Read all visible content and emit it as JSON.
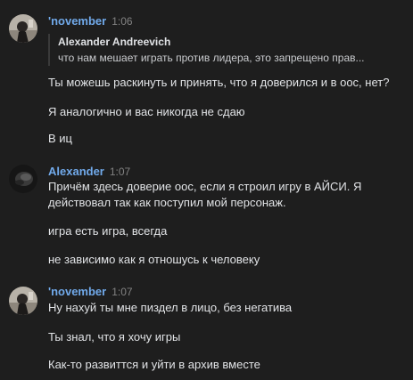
{
  "messages": [
    {
      "author": "'november",
      "time": "1:06",
      "reply": {
        "author": "Alexander Andreevich",
        "text": "что нам мешает играть против лидера, это запрещено прав..."
      },
      "lines": [
        "Ты можешь раскинуть и принять, что я доверился и в оос, нет?",
        "Я аналогично и вас никогда не сдаю",
        "В иц"
      ]
    },
    {
      "author": "Alexander",
      "time": "1:07",
      "lines": [
        "Причём здесь доверие оос, если я строил игру в АЙСИ. Я",
        "действовал так как поступил мой персонаж.",
        "игра есть игра, всегда",
        "не зависимо как я отношусь к человеку"
      ]
    },
    {
      "author": "'november",
      "time": "1:07",
      "lines": [
        "Ну нахуй ты мне пиздел в лицо, без негатива",
        "Ты знал, что я хочу игры",
        "Как-то развиттся и уйти в архив вместе"
      ]
    }
  ],
  "colors": {
    "background": "#1e1e1e",
    "author": "#71aaeb",
    "text": "#e1e3e6",
    "time": "#828282"
  }
}
